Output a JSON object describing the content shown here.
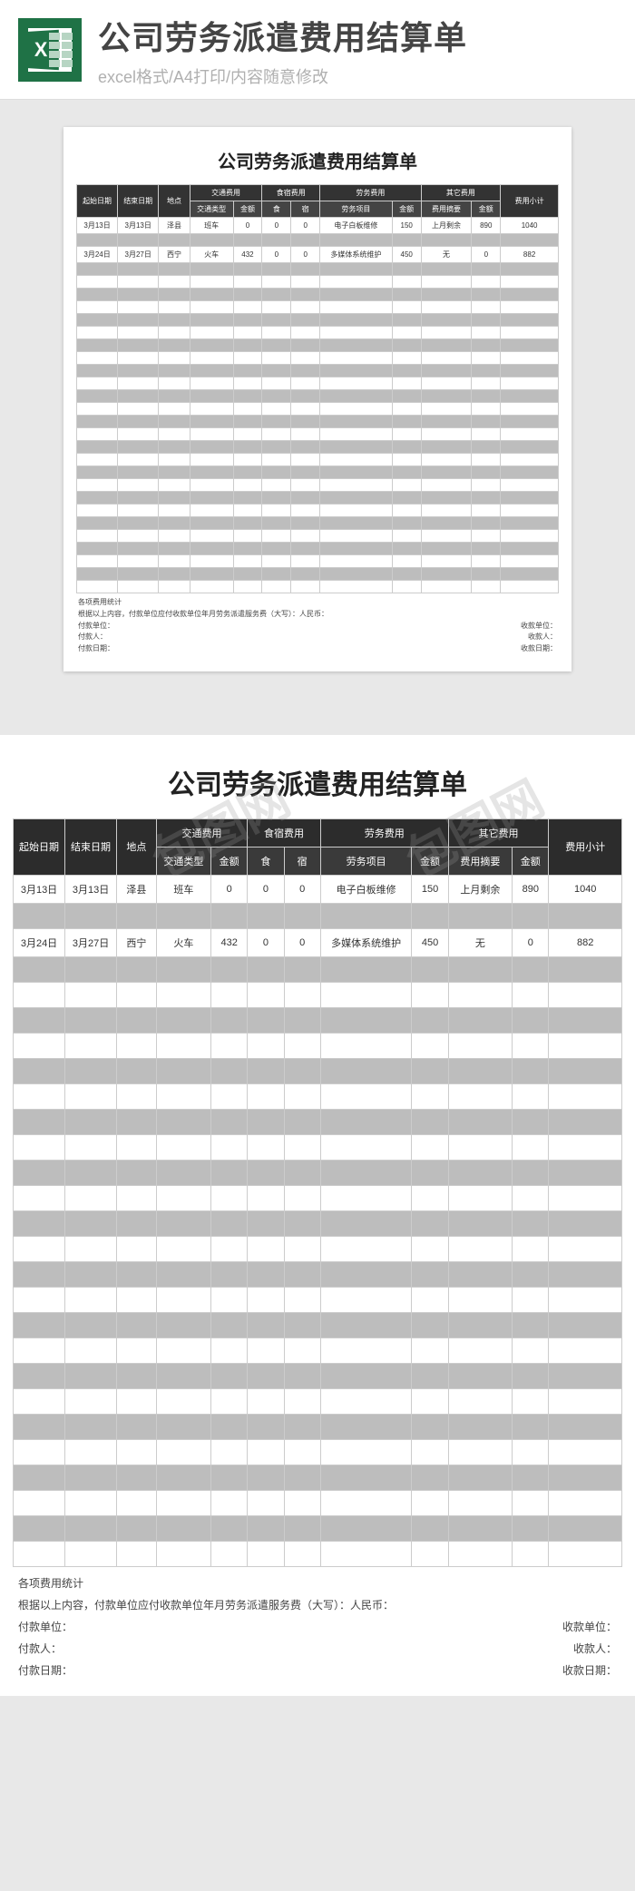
{
  "header": {
    "title": "公司劳务派遣费用结算单",
    "subtitle": "excel格式/A4打印/内容随意修改",
    "icon_letter": "X"
  },
  "doc": {
    "title": "公司劳务派遣费用结算单",
    "columns_main": [
      "起始日期",
      "结束日期",
      "地点",
      "交通费用",
      "食宿费用",
      "劳务费用",
      "其它费用",
      "费用小计"
    ],
    "columns_sub": [
      "交通类型",
      "金额",
      "食",
      "宿",
      "劳务项目",
      "金额",
      "费用摘要",
      "金额"
    ],
    "rows": [
      {
        "start": "3月13日",
        "end": "3月13日",
        "place": "泽县",
        "trans_type": "班车",
        "trans_amt": "0",
        "food": "0",
        "lodge": "0",
        "service_item": "电子白板维修",
        "service_amt": "150",
        "other_desc": "上月剩余",
        "other_amt": "890",
        "subtotal": "1040"
      },
      {
        "start": "3月24日",
        "end": "3月27日",
        "place": "西宁",
        "trans_type": "火车",
        "trans_amt": "432",
        "food": "0",
        "lodge": "0",
        "service_item": "多媒体系统维护",
        "service_amt": "450",
        "other_desc": "无",
        "other_amt": "0",
        "subtotal": "882"
      }
    ],
    "summary_label": "各项费用统计",
    "agreement": "根据以上内容，付款单位应付收款单位年月劳务派遣服务费（大写）：人民币：",
    "payer_unit_label": "付款单位：",
    "payee_unit_label": "收款单位：",
    "payer_label": "付款人：",
    "payee_label": "收款人：",
    "pay_date_label": "付款日期：",
    "recv_date_label": "收款日期："
  },
  "watermark": "包图网"
}
